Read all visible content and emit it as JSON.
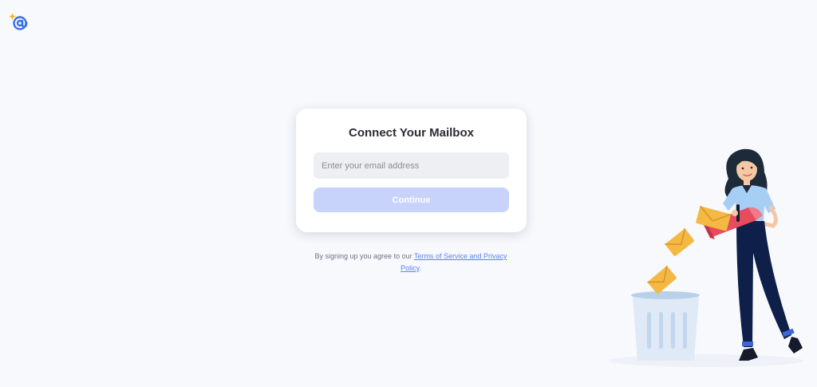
{
  "brand": {
    "logo_icon": "at-sparkle-logo-icon",
    "accent_color": "#3a6ee8",
    "sparkle_color": "#f5b01e"
  },
  "card": {
    "title": "Connect Your Mailbox",
    "email_placeholder": "Enter your email address",
    "email_value": "",
    "continue_label": "Continue",
    "continue_color": "#c7d3fb"
  },
  "legal": {
    "prefix": "By signing up you agree to our",
    "link_text": "Terms of Service and Privacy Policy",
    "suffix": "."
  },
  "illustration": {
    "icon": "woman-emptying-mailbox-into-trash-icon"
  }
}
